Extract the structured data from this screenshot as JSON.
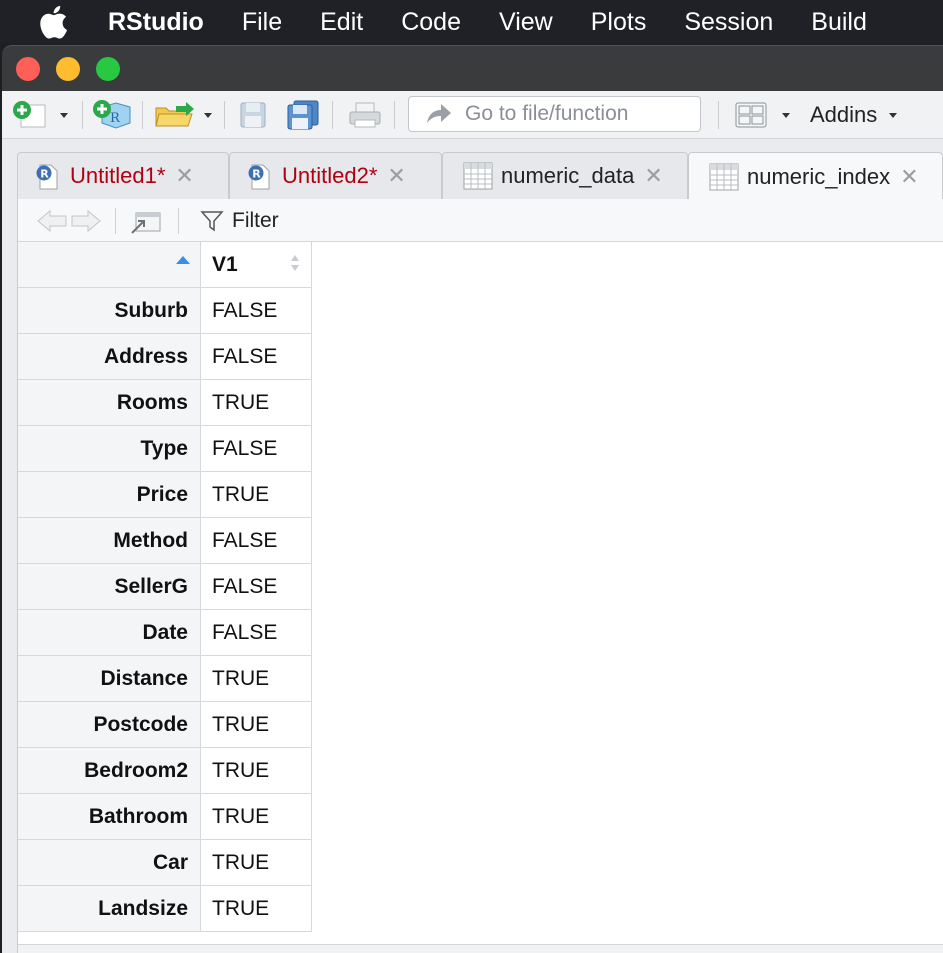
{
  "menubar": {
    "app_name": "RStudio",
    "items": [
      "File",
      "Edit",
      "Code",
      "View",
      "Plots",
      "Session",
      "Build"
    ]
  },
  "toolbar": {
    "goto_placeholder": "Go to file/function",
    "addins_label": "Addins"
  },
  "tabs": [
    {
      "label": "Untitled1*",
      "kind": "r-script",
      "modified": true
    },
    {
      "label": "Untitled2*",
      "kind": "r-script",
      "modified": true
    },
    {
      "label": "numeric_data",
      "kind": "data-view",
      "modified": false
    },
    {
      "label": "numeric_index",
      "kind": "data-view",
      "modified": false,
      "active": true
    }
  ],
  "viewer": {
    "filter_label": "Filter",
    "column_header": "V1",
    "rows": [
      {
        "name": "Suburb",
        "value": "FALSE"
      },
      {
        "name": "Address",
        "value": "FALSE"
      },
      {
        "name": "Rooms",
        "value": "TRUE"
      },
      {
        "name": "Type",
        "value": "FALSE"
      },
      {
        "name": "Price",
        "value": "TRUE"
      },
      {
        "name": "Method",
        "value": "FALSE"
      },
      {
        "name": "SellerG",
        "value": "FALSE"
      },
      {
        "name": "Date",
        "value": "FALSE"
      },
      {
        "name": "Distance",
        "value": "TRUE"
      },
      {
        "name": "Postcode",
        "value": "TRUE"
      },
      {
        "name": "Bedroom2",
        "value": "TRUE"
      },
      {
        "name": "Bathroom",
        "value": "TRUE"
      },
      {
        "name": "Car",
        "value": "TRUE"
      },
      {
        "name": "Landsize",
        "value": "TRUE"
      }
    ]
  },
  "colors": {
    "modified_tab": "#b00012",
    "traffic_red": "#fe5f57",
    "traffic_yellow": "#febc2e",
    "traffic_green": "#28c840",
    "sort_indicator": "#3a8ee6"
  }
}
